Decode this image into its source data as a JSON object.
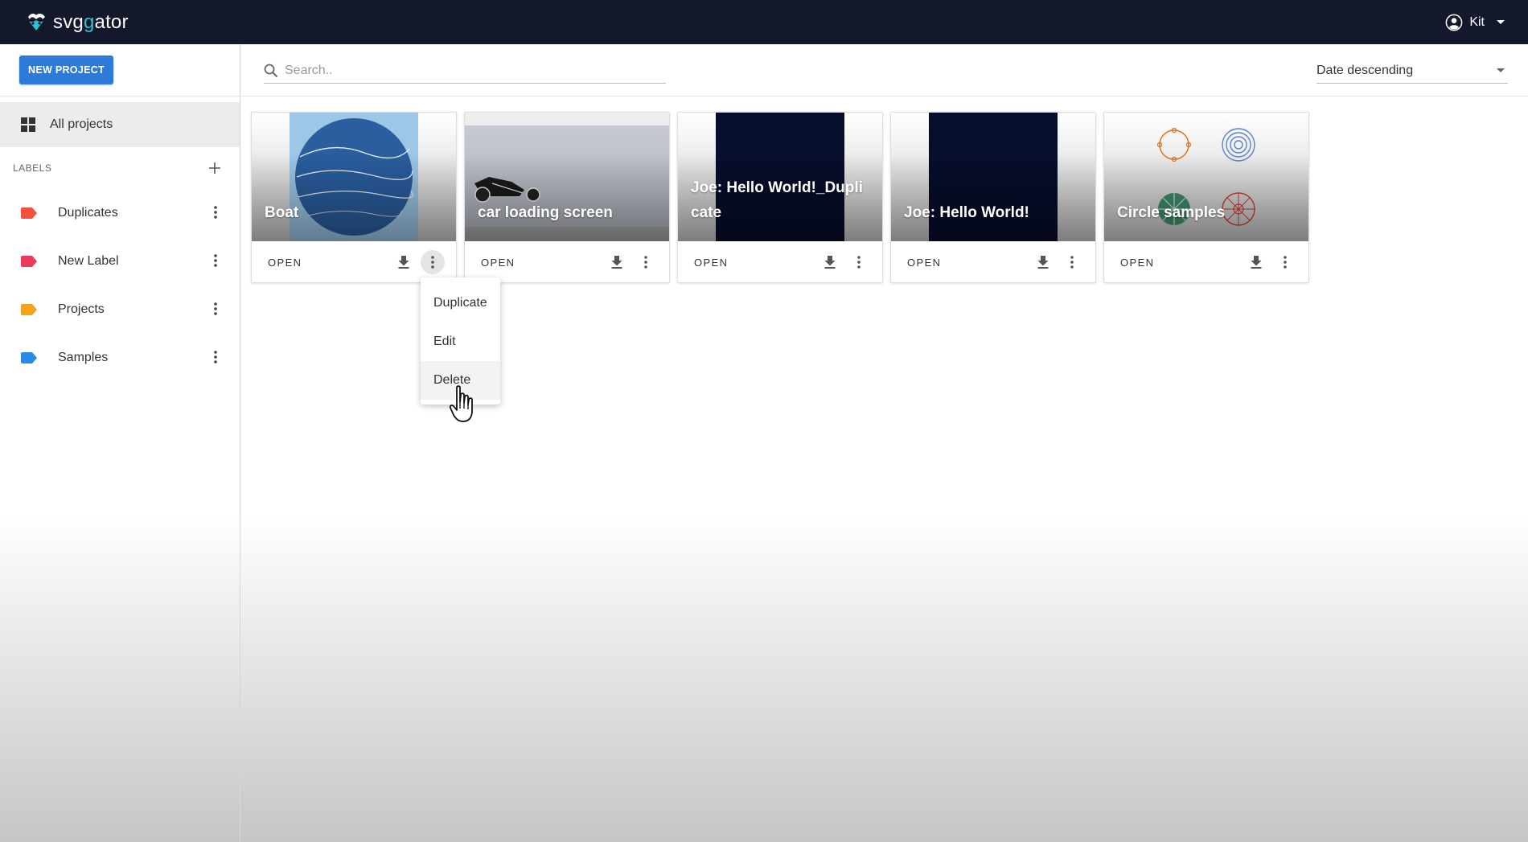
{
  "app": {
    "logo_prefix": "svg",
    "logo_accent": "g",
    "logo_suffix": "ator",
    "user_name": "Kit"
  },
  "colors": {
    "topbar": "#14182b",
    "primary": "#2d7bd9",
    "logo_accent": "#2ec4d6"
  },
  "sidebar": {
    "new_project_label": "NEW PROJECT",
    "all_projects_label": "All projects",
    "labels_heading": "LABELS",
    "labels": [
      {
        "label": "Duplicates",
        "color": "#f4523b"
      },
      {
        "label": "New Label",
        "color": "#ec3a5a"
      },
      {
        "label": "Projects",
        "color": "#f5a21d"
      },
      {
        "label": "Samples",
        "color": "#2b8ae6"
      }
    ]
  },
  "toolbar": {
    "search_placeholder": "Search..",
    "sort_value": "Date descending"
  },
  "projects": [
    {
      "title": "Boat",
      "open_label": "OPEN"
    },
    {
      "title": "car loading screen",
      "open_label": "OPEN"
    },
    {
      "title": "Joe: Hello World!_Duplicate",
      "open_label": "OPEN"
    },
    {
      "title": "Joe: Hello World!",
      "open_label": "OPEN"
    },
    {
      "title": "Circle samples",
      "open_label": "OPEN"
    }
  ],
  "context_menu": {
    "items": [
      "Duplicate",
      "Edit",
      "Delete"
    ]
  },
  "icons": {
    "search": "search-icon",
    "user": "account-circle-icon",
    "download": "download-icon",
    "more": "more-vert-icon",
    "grid": "grid-icon",
    "add": "plus-icon",
    "label": "label-tag-icon",
    "cursor": "hand-pointer-icon"
  }
}
